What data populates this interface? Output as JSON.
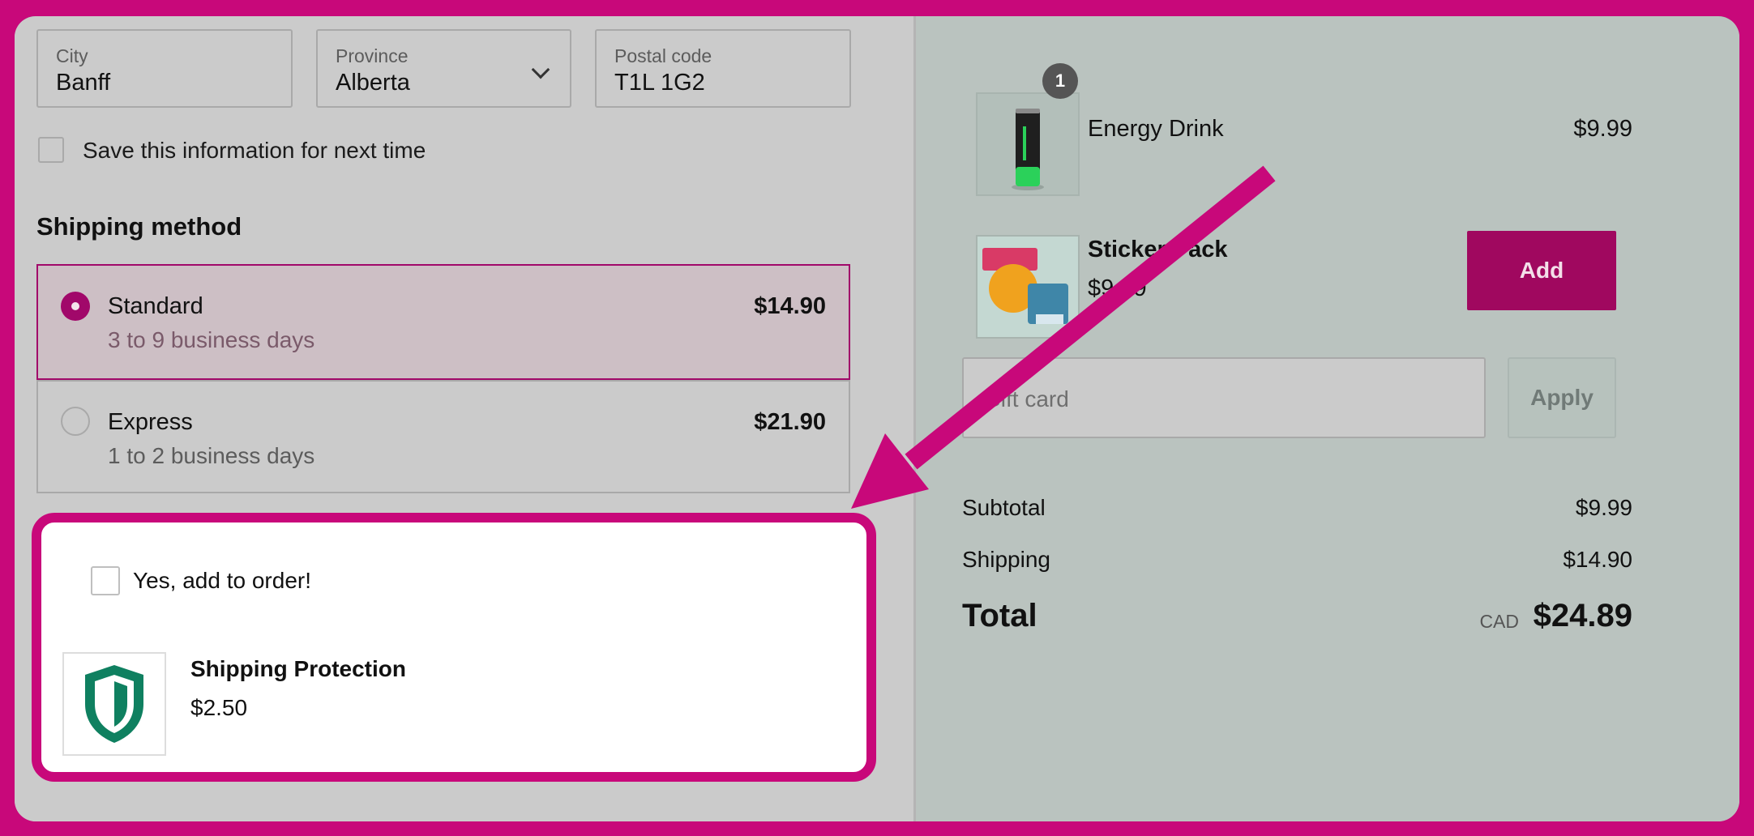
{
  "address": {
    "city": {
      "label": "City",
      "value": "Banff"
    },
    "province": {
      "label": "Province",
      "value": "Alberta"
    },
    "postal": {
      "label": "Postal code",
      "value": "T1L 1G2"
    }
  },
  "save_info_label": "Save this information for next time",
  "shipping": {
    "title": "Shipping method",
    "options": [
      {
        "name": "Standard",
        "desc": "3 to 9 business days",
        "price": "$14.90"
      },
      {
        "name": "Express",
        "desc": "1 to 2 business days",
        "price": "$21.90"
      }
    ]
  },
  "protection": {
    "checkbox_label": "Yes, add to order!",
    "name": "Shipping Protection",
    "price": "$2.50"
  },
  "cart": {
    "item": {
      "name": "Energy Drink",
      "price": "$9.99",
      "quantity": "1"
    },
    "upsell": {
      "name": "Sticker Pack",
      "price": "$9.99",
      "button": "Add"
    }
  },
  "gift": {
    "placeholder": "Gift card",
    "button": "Apply"
  },
  "summary": {
    "subtotal_label": "Subtotal",
    "subtotal": "$9.99",
    "shipping_label": "Shipping",
    "shipping": "$14.90",
    "total_label": "Total",
    "currency": "CAD",
    "total": "$24.89"
  },
  "colors": {
    "accent": "#a1086a",
    "highlight": "#c8087a",
    "shield": "#0f8060"
  }
}
